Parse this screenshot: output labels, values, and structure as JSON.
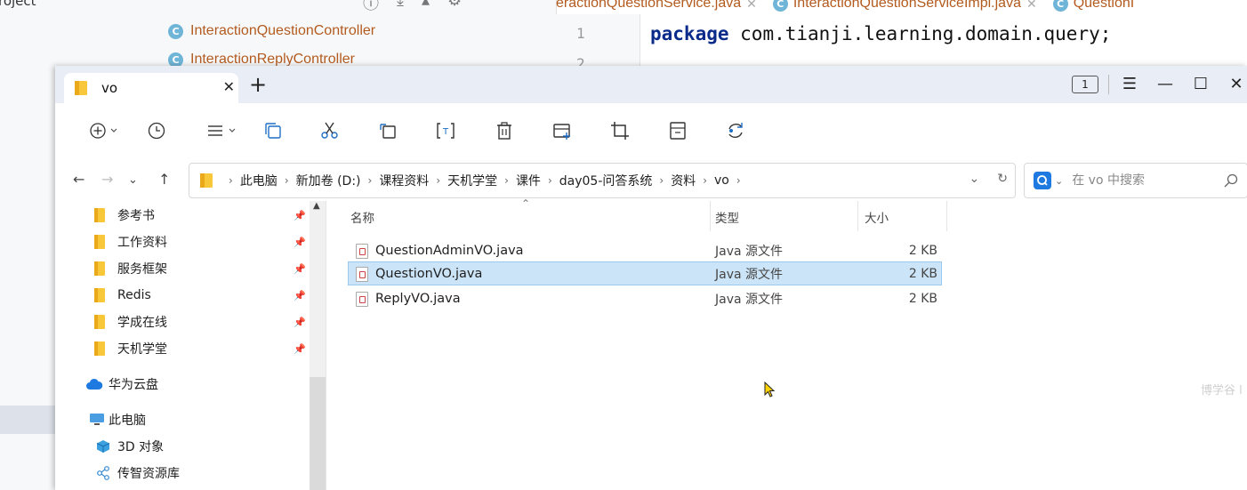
{
  "ide": {
    "project_label": "roject",
    "tree_items": [
      "InteractionQuestionController",
      "InteractionReplyController"
    ],
    "class_badge": "C",
    "editor_tabs": [
      "eractionQuestionService.java",
      "InteractionQuestionServiceImpl.java",
      "QuestionI"
    ],
    "line_numbers": [
      "1",
      "2"
    ],
    "code_keyword": "package",
    "code_rest": " com.tianji.learning.domain.query;"
  },
  "explorer": {
    "tab_title": "vo",
    "window_count": "1",
    "breadcrumb": [
      "此电脑",
      "新加卷 (D:)",
      "课程资料",
      "天机学堂",
      "课件",
      "day05-问答系统",
      "资料",
      "vo"
    ],
    "search_placeholder": "在 vo 中搜索",
    "nav_items": [
      {
        "label": "参考书",
        "pinned": true
      },
      {
        "label": "工作资料",
        "pinned": true
      },
      {
        "label": "服务框架",
        "pinned": true
      },
      {
        "label": "Redis",
        "pinned": true
      },
      {
        "label": "学成在线",
        "pinned": true
      },
      {
        "label": "天机学堂",
        "pinned": true
      }
    ],
    "cloud_label": "华为云盘",
    "pc_label": "此电脑",
    "pc_children": [
      "3D 对象",
      "传智资源库"
    ],
    "columns": {
      "name": "名称",
      "type": "类型",
      "size": "大小"
    },
    "files": [
      {
        "name": "QuestionAdminVO.java",
        "type": "Java 源文件",
        "size": "2 KB",
        "selected": false
      },
      {
        "name": "QuestionVO.java",
        "type": "Java 源文件",
        "size": "2 KB",
        "selected": true
      },
      {
        "name": "ReplyVO.java",
        "type": "Java 源文件",
        "size": "2 KB",
        "selected": false
      }
    ],
    "watermark": "博学谷 l"
  }
}
